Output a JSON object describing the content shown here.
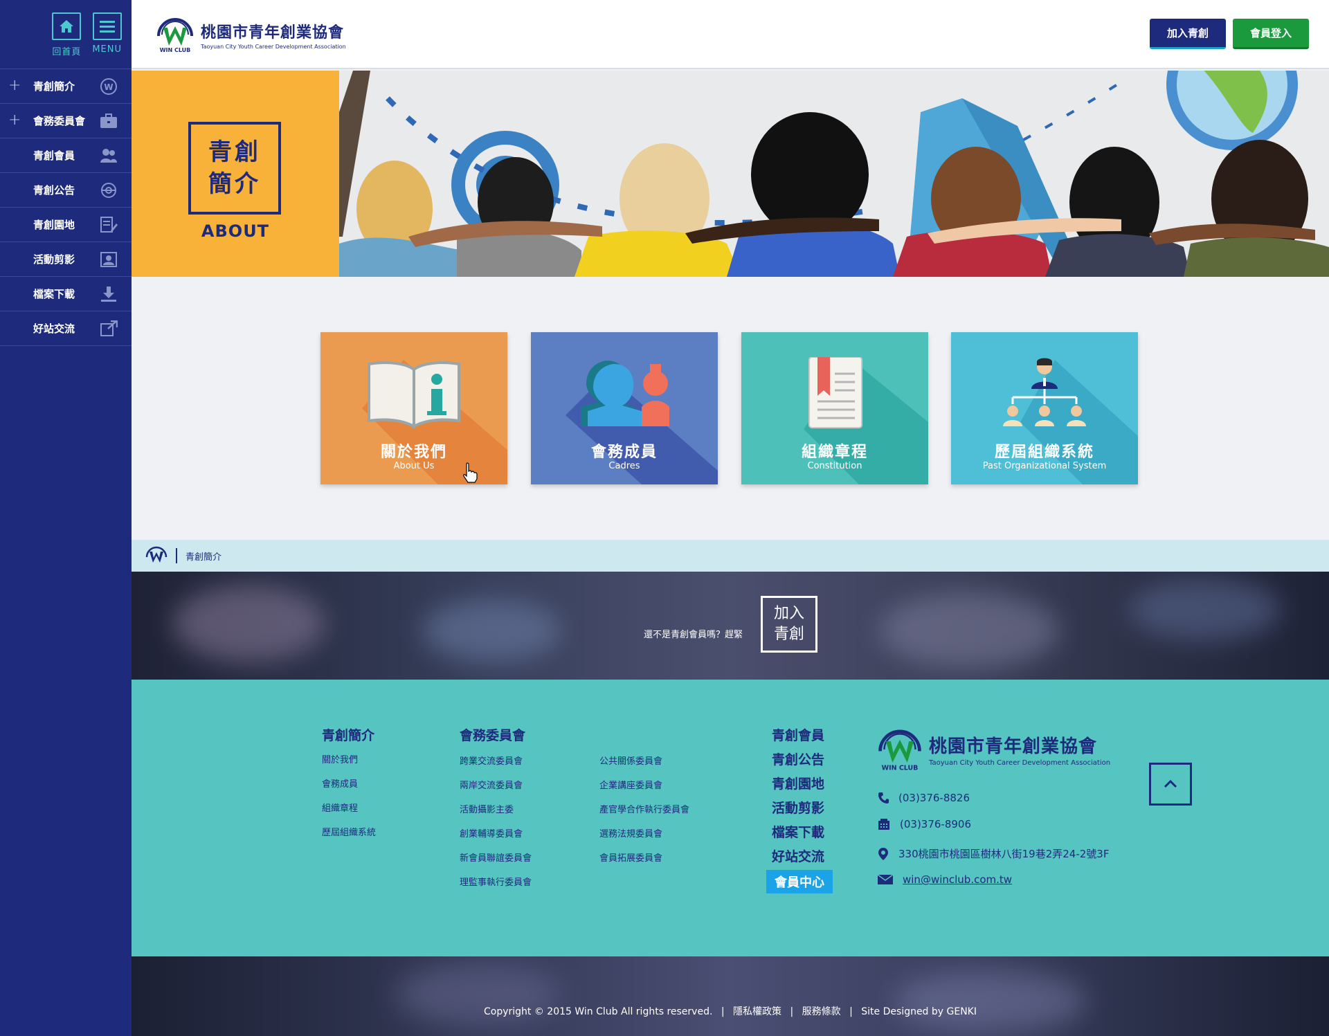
{
  "sidebar": {
    "home_label": "回首頁",
    "menu_label": "MENU",
    "items": [
      {
        "label": "青創簡介",
        "expandable": "+",
        "icon": "winclub-logo-icon"
      },
      {
        "label": "會務委員會",
        "expandable": "+",
        "icon": "briefcase-icon"
      },
      {
        "label": "青創會員",
        "expandable": "",
        "icon": "users-icon"
      },
      {
        "label": "青創公告",
        "expandable": "",
        "icon": "globe-icon"
      },
      {
        "label": "青創園地",
        "expandable": "",
        "icon": "document-edit-icon"
      },
      {
        "label": "活動剪影",
        "expandable": "",
        "icon": "photo-icon"
      },
      {
        "label": "檔案下載",
        "expandable": "",
        "icon": "download-icon"
      },
      {
        "label": "好站交流",
        "expandable": "",
        "icon": "external-link-icon"
      }
    ]
  },
  "header": {
    "logo_mark": "WIN CLUB",
    "logo_cn": "桃園市青年創業協會",
    "logo_en": "Taoyuan City Youth Career Development Association",
    "join_button": "加入青創",
    "login_button": "會員登入"
  },
  "hero": {
    "title_line1": "青創",
    "title_line2": "簡介",
    "subtitle": "ABOUT"
  },
  "cards": [
    {
      "cn": "關於我們",
      "en": "About Us",
      "color": "#eb9b4f",
      "shadow": "#e37e38",
      "icon": "book-info-icon"
    },
    {
      "cn": "會務成員",
      "en": "Cadres",
      "color": "#5c7fc4",
      "shadow": "#3c56a8",
      "icon": "members-icon"
    },
    {
      "cn": "組織章程",
      "en": "Constitution",
      "color": "#4dc1b9",
      "shadow": "#30a8a2",
      "icon": "bookmark-document-icon"
    },
    {
      "cn": "歷屆組織系統",
      "en": "Past Organizational System",
      "color": "#4fbfd8",
      "shadow": "#36a5c3",
      "icon": "org-chart-icon"
    }
  ],
  "breadcrumb": {
    "current": "青創簡介"
  },
  "join_band": {
    "prompt": "還不是青創會員嗎？趕緊",
    "box_line1": "加入",
    "box_line2": "青創"
  },
  "footer": {
    "col1": {
      "title": "青創簡介",
      "links": [
        "關於我們",
        "會務成員",
        "組織章程",
        "歷屆組織系統"
      ]
    },
    "col2": {
      "title": "會務委員會",
      "links_a": [
        "跨業交流委員會",
        "兩岸交流委員會",
        "活動攝影主委",
        "創業輔導委員會",
        "新會員聯誼委員會",
        "理監事執行委員會"
      ],
      "links_b": [
        "公共關係委員會",
        "企業講座委員會",
        "產官學合作執行委員會",
        "選務法規委員會",
        "會員拓展委員會"
      ]
    },
    "col3": {
      "links": [
        "青創會員",
        "青創公告",
        "青創園地",
        "活動剪影",
        "檔案下載",
        "好站交流"
      ],
      "member_center": "會員中心"
    },
    "contact": {
      "logo_mark": "WIN CLUB",
      "logo_cn": "桃園市青年創業協會",
      "logo_en": "Taoyuan City Youth Career Development Association",
      "phone": "(03)376-8826",
      "fax": "(03)376-8906",
      "address": "330桃園市桃園區樹林八街19巷2弄24-2號3F",
      "email": "win@winclub.com.tw"
    }
  },
  "copyright": {
    "text": "Copyright © 2015 Win Club  All rights reserved.",
    "sep": "|",
    "privacy": "隱私權政策",
    "terms": "服務條款",
    "designed": "Site Designed by GENKI"
  },
  "colors": {
    "sidebar": "#1e2b7d",
    "accent_teal": "#4ec8d0",
    "footer": "#56c4c0",
    "hero_orange": "#f8b23a",
    "join_button": "#1e2b7d",
    "login_button": "#1a9a3c"
  }
}
